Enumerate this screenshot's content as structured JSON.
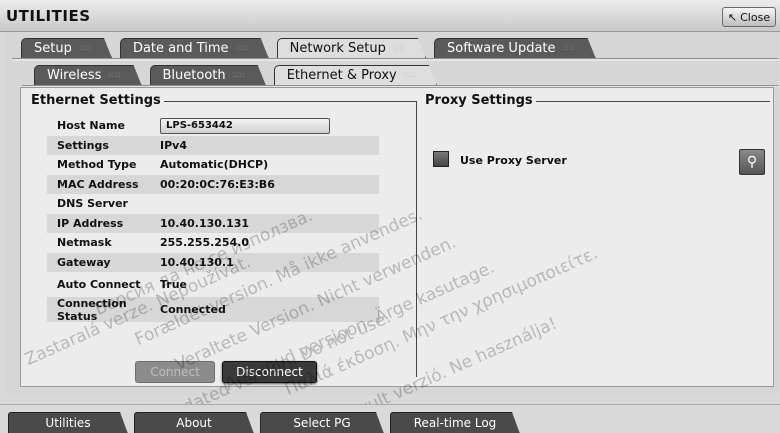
{
  "window": {
    "title": "UTILITIES",
    "close_label": "Close"
  },
  "main_tabs": [
    {
      "label": "Setup",
      "active": false
    },
    {
      "label": "Date and Time",
      "active": false
    },
    {
      "label": "Network Setup",
      "active": true
    },
    {
      "label": "Software Update",
      "active": false
    }
  ],
  "sub_tabs": [
    {
      "label": "Wireless",
      "active": false
    },
    {
      "label": "Bluetooth",
      "active": false
    },
    {
      "label": "Ethernet & Proxy",
      "active": true
    }
  ],
  "ethernet": {
    "title": "Ethernet Settings",
    "rows": [
      {
        "label": "Host Name",
        "value": "LPS-653442"
      },
      {
        "label": "Settings",
        "value": "IPv4"
      },
      {
        "label": "Method Type",
        "value": "Automatic(DHCP)"
      },
      {
        "label": "MAC Address",
        "value": "00:20:0C:76:E3:B6"
      },
      {
        "label": "DNS Server",
        "value": ""
      },
      {
        "label": "IP Address",
        "value": "10.40.130.131"
      },
      {
        "label": "Netmask",
        "value": "255.255.254.0"
      },
      {
        "label": "Gateway",
        "value": "10.40.130.1"
      },
      {
        "label": "Auto Connect",
        "value": "True"
      },
      {
        "label": "Connection Status",
        "value": "Connected"
      }
    ],
    "connect_label": "Connect",
    "disconnect_label": "Disconnect"
  },
  "proxy": {
    "title": "Proxy Settings",
    "use_proxy_label": "Use Proxy Server",
    "use_proxy_checked": false,
    "search_icon": "search-icon"
  },
  "bottom_bar": [
    {
      "label": "Utilities"
    },
    {
      "label": "About"
    },
    {
      "label": "Select PG"
    },
    {
      "label": "Real-time Log"
    }
  ],
  "watermark_lines": [
    "Версия да не се използва.",
    "Zastaralá verze. Nepoužívat.",
    "Forældet version. Må ikke anvendes.",
    "Veraltete Version. Nicht verwenden.",
    "Aegunud versioon. Ärge kasutage.",
    "Παλιά έκδοση. Μην την χρησιμοποιείτε.",
    "Outdated version. Do not use.",
    "Elavult verzió. Ne használja!"
  ],
  "colors": {
    "tab_inactive": "#5a5a5a",
    "tab_active": "#dedede",
    "content_bg": "#ececec"
  }
}
